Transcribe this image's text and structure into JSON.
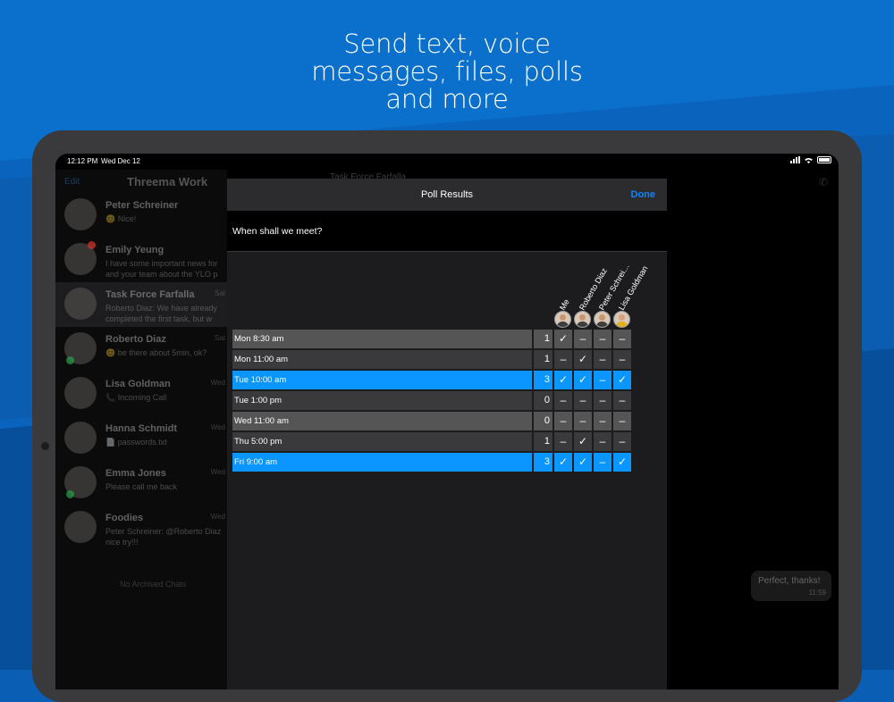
{
  "headline": [
    "Send text, voice",
    "messages, files, polls",
    "and more"
  ],
  "status_bar": {
    "time": "12:12 PM",
    "date": "Wed Dec 12"
  },
  "sidebar": {
    "edit": "Edit",
    "title": "Threema Work",
    "chats": [
      {
        "name": "Peter Schreiner",
        "preview": "😊 Nice!",
        "date": ""
      },
      {
        "name": "Emily Yeung",
        "preview": "I have some important news for\nand your team about the YLO p",
        "date": ""
      },
      {
        "name": "Task Force Farfalla",
        "preview": "Roberto Diaz: We have already\ncompleted the first task, but w",
        "date": "Sat"
      },
      {
        "name": "Roberto Diaz",
        "preview": "😊 be there about 5min, ok?",
        "date": "Sat"
      },
      {
        "name": "Lisa Goldman",
        "preview": "📞 Incoming Call",
        "date": "Wed"
      },
      {
        "name": "Hanna Schmidt",
        "preview": "📄 passwords.txt",
        "date": "Wed"
      },
      {
        "name": "Emma Jones",
        "preview": "Please call me back",
        "date": "Wed"
      },
      {
        "name": "Foodies",
        "preview": "Peter Schreiner: @Roberto Diaz\nnice try!!!",
        "date": "Wed"
      }
    ],
    "footer": "No Archived Chats"
  },
  "chat_area": {
    "title": "Task Force Farfalla",
    "bubble_text": "Perfect, thanks!",
    "bubble_time": "11:59"
  },
  "poll": {
    "title": "Poll Results",
    "done": "Done",
    "question": "When shall we meet?",
    "voters": [
      "Me",
      "Roberto Diaz",
      "Peter Schrei…",
      "Lisa Goldman"
    ],
    "rows": [
      {
        "option": "Mon 8:30 am",
        "count": "1",
        "votes": [
          "✓",
          "–",
          "–",
          "–"
        ]
      },
      {
        "option": "Mon 11:00 am",
        "count": "1",
        "votes": [
          "–",
          "✓",
          "–",
          "–"
        ]
      },
      {
        "option": "Tue 10:00 am",
        "count": "3",
        "votes": [
          "✓",
          "✓",
          "–",
          "✓"
        ]
      },
      {
        "option": "Tue 1:00 pm",
        "count": "0",
        "votes": [
          "–",
          "–",
          "–",
          "–"
        ]
      },
      {
        "option": "Wed 11:00 am",
        "count": "0",
        "votes": [
          "–",
          "–",
          "–",
          "–"
        ]
      },
      {
        "option": "Thu 5:00 pm",
        "count": "1",
        "votes": [
          "–",
          "✓",
          "–",
          "–"
        ]
      },
      {
        "option": "Fri 9:00 am",
        "count": "3",
        "votes": [
          "✓",
          "✓",
          "–",
          "✓"
        ]
      }
    ]
  },
  "colors": {
    "accent": "#0a84ff",
    "winner_row": "#0a95ff",
    "background": "#0a5fb5"
  }
}
